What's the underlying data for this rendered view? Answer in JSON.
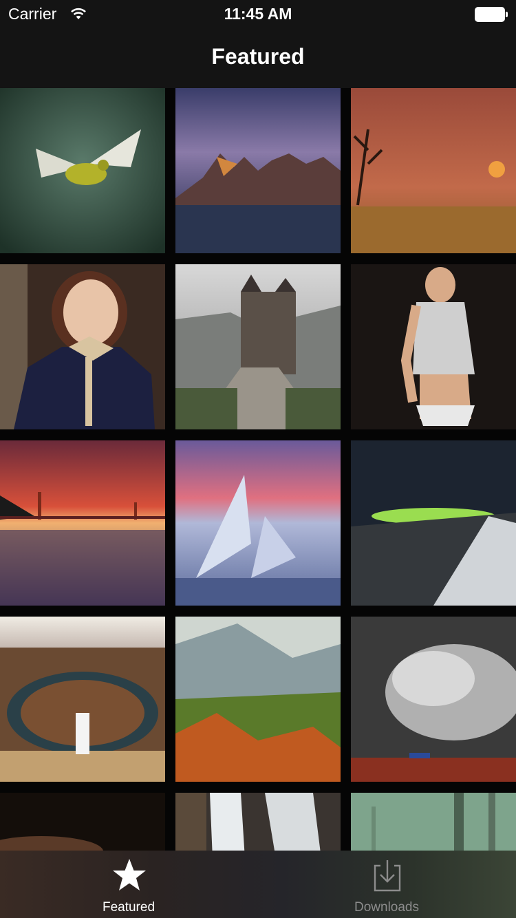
{
  "status_bar": {
    "carrier": "Carrier",
    "time": "11:45 AM",
    "wifi_icon": "wifi-icon",
    "battery_icon": "battery-full-icon"
  },
  "nav": {
    "title": "Featured"
  },
  "tabs": [
    {
      "label": "Featured",
      "icon": "star-icon",
      "selected": true
    },
    {
      "label": "Downloads",
      "icon": "download-icon",
      "selected": false
    }
  ],
  "colors": {
    "bar_background": "#141414",
    "tab_active": "#ffffff",
    "tab_inactive": "#8c8c8c"
  }
}
